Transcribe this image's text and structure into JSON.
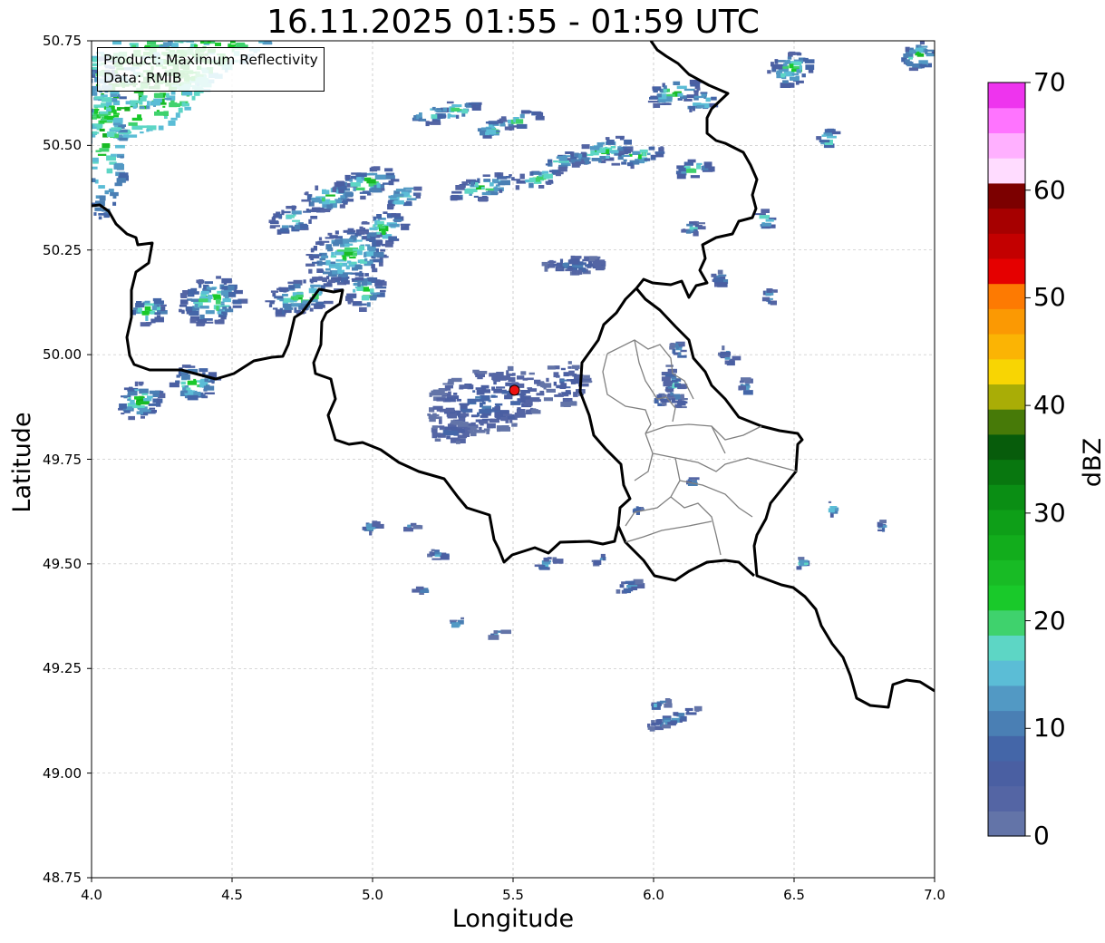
{
  "title": "16.11.2025 01:55 - 01:59 UTC",
  "xlabel": "Longitude",
  "ylabel": "Latitude",
  "annotation": {
    "product": "Product: Maximum Reflectivity",
    "source": "Data: RMIB"
  },
  "x_ticks": [
    "4.0",
    "4.5",
    "5.0",
    "5.5",
    "6.0",
    "6.5",
    "7.0"
  ],
  "y_ticks": [
    "50.75",
    "50.50",
    "50.25",
    "50.00",
    "49.75",
    "49.50",
    "49.25",
    "49.00",
    "48.75"
  ],
  "colorbar": {
    "label": "dBZ",
    "ticks": [
      "0",
      "10",
      "20",
      "30",
      "40",
      "50",
      "60",
      "70"
    ],
    "colors": [
      "#6374a8",
      "#5465a4",
      "#4a5fa2",
      "#4466a8",
      "#4a7fb4",
      "#5299c4",
      "#5bbdd6",
      "#5dd6c5",
      "#3fd26d",
      "#19c92a",
      "#18bb25",
      "#12ad1c",
      "#0e9f18",
      "#0a8e14",
      "#08770f",
      "#075c0b",
      "#477a08",
      "#a9ad06",
      "#f8d503",
      "#fbb404",
      "#fb9903",
      "#fd7a02",
      "#e50000",
      "#c30000",
      "#a60000",
      "#7c0000",
      "#ffdcff",
      "#ffb0ff",
      "#ff74ff",
      "#ee34ee"
    ]
  },
  "map": {
    "lon_range": [
      4.0,
      7.0
    ],
    "lat_range": [
      48.75,
      50.75
    ],
    "radar_site": {
      "lon": 5.505,
      "lat": 49.915
    },
    "radar_marker_color": "#ee1111",
    "grid": true,
    "border_color": "#000000",
    "district_color": "#808080"
  }
}
